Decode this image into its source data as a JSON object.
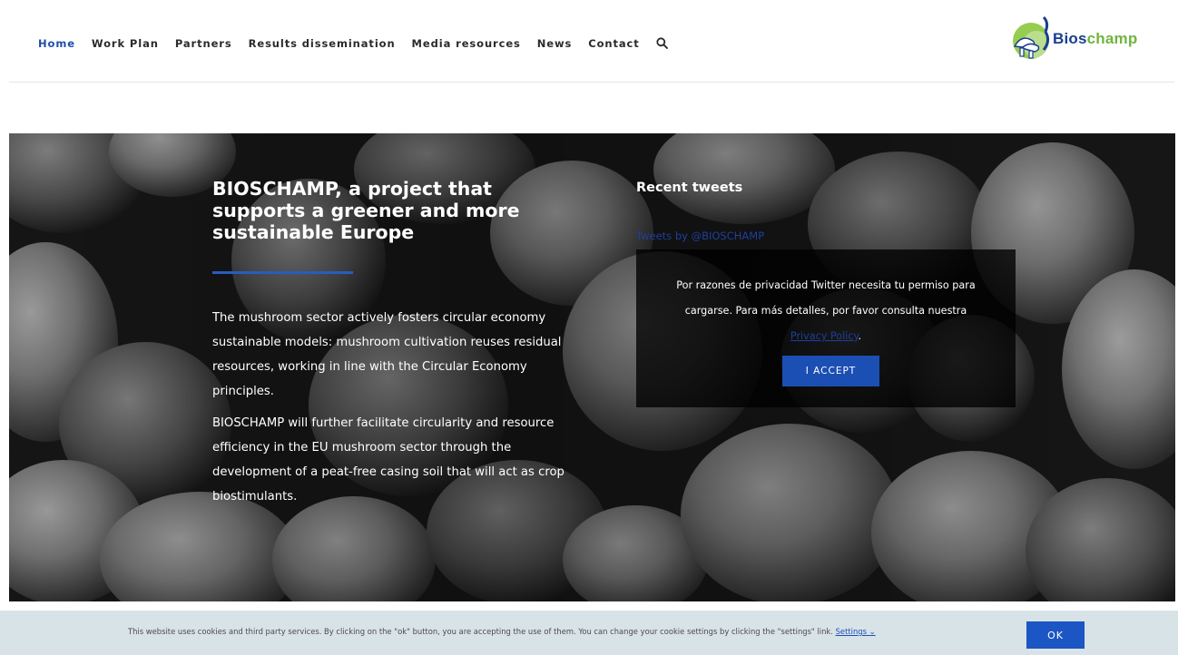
{
  "nav": {
    "items": [
      "Home",
      "Work Plan",
      "Partners",
      "Results dissemination",
      "Media resources",
      "News",
      "Contact"
    ],
    "search_icon": "search-icon"
  },
  "logo": {
    "part1": "Bios",
    "part2": "champ",
    "icon": "mushroom-logo-icon"
  },
  "hero": {
    "title": "BIOSCHAMP, a project that supports a greener and more sustainable Europe",
    "paragraphs": [
      "The mushroom sector actively fosters circular economy sustainable models: mushroom cultivation reuses residual resources, working in line with the Circular Economy principles.",
      "BIOSCHAMP will further facilitate circularity and resource efficiency in the EU mushroom sector through the development of a peat-free casing soil that will act as crop biostimulants."
    ]
  },
  "tweets": {
    "title": "Recent tweets",
    "link": "Tweets by @BIOSCHAMP",
    "message_line1": "Por razones de privacidad Twitter necesita tu permiso para",
    "message_line2": "cargarse. Para más detalles, por favor consulta nuestra",
    "privacy_link": "Privacy Policy",
    "accept_button": "I ACCEPT"
  },
  "cookie": {
    "text": "This website uses cookies and third party services. By clicking on the \"ok\" button, you are accepting the use of them. You can change your cookie settings by clicking the \"settings\" link.",
    "settings_link": "Settings",
    "ok_button": "OK"
  },
  "colors": {
    "accent": "#1c4fb3",
    "nav_active": "#1f4fa8",
    "logo_blue": "#1a3f8f",
    "logo_green": "#6fb53f",
    "cookie_bg": "#d8e3e8"
  }
}
